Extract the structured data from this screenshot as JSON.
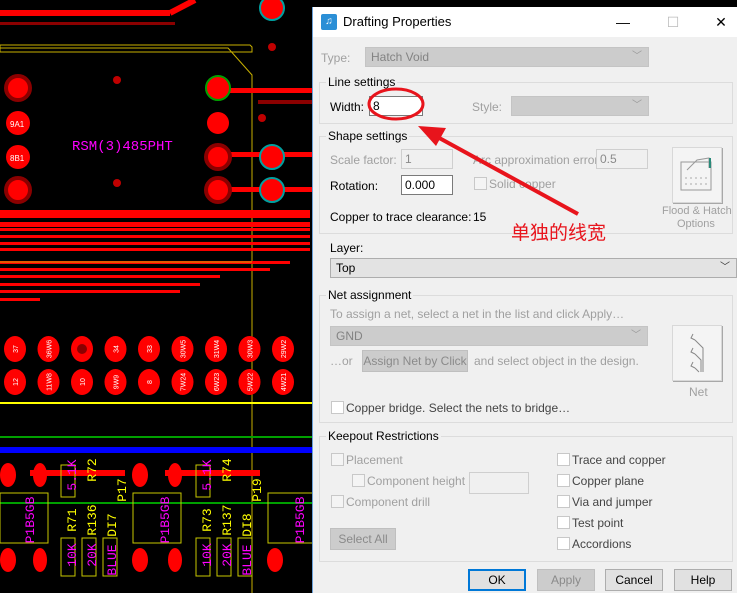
{
  "pcb": {
    "component_label": "RSM(3)485PHT",
    "pin_labels_left": [
      "9A1",
      "8B1"
    ],
    "header_pins_top": [
      "37",
      "36W6",
      "",
      "34",
      "33",
      "30W5",
      "31W4",
      "30W3",
      "29W2"
    ],
    "header_pins_bottom": [
      "12",
      "11W8",
      "10",
      "9W9",
      "8",
      "7W24",
      "6W23",
      "5W22",
      "4W21"
    ],
    "bottom_parts": [
      "P1B5GB",
      "R71",
      "R136",
      "DI7",
      "R72",
      "P17",
      "5.1K",
      "10K",
      "20K",
      "BLUE",
      "P1B5GB",
      "R73",
      "R137",
      "DI8",
      "R74",
      "P19",
      "5.1K",
      "10K",
      "20K",
      "BLUE",
      "P1B5GB"
    ],
    "colors": {
      "background": "#000000",
      "copper_top": "#ff0000",
      "copper_dark": "#8b0000",
      "silkscreen": "#ffff00",
      "label": "#ff00ff",
      "green": "#00a000",
      "blue": "#0000ff"
    }
  },
  "dialog": {
    "title": "Drafting Properties",
    "window_buttons": {
      "minimize": "—",
      "maximize": "☐",
      "close": "✕"
    },
    "type": {
      "label": "Type:",
      "value": "Hatch Void"
    },
    "line_settings": {
      "title": "Line settings",
      "width_label": "Width:",
      "width_value": "8",
      "style_label": "Style:",
      "style_value": ""
    },
    "shape_settings": {
      "title": "Shape settings",
      "scale_factor_label": "Scale factor:",
      "scale_factor_value": "1",
      "arc_error_label": "Arc approximation error:",
      "arc_error_value": "0.5",
      "rotation_label": "Rotation:",
      "rotation_value": "0.000",
      "solid_copper_label": "Solid copper",
      "solid_copper_checked": false,
      "clearance_label": "Copper to trace clearance:",
      "clearance_value": "15",
      "flood_hatch_label_1": "Flood & Hatch",
      "flood_hatch_label_2": "Options"
    },
    "layer": {
      "label": "Layer:",
      "value": "Top"
    },
    "net_assignment": {
      "title": "Net assignment",
      "hint": "To assign a net, select a net in the list and click Apply…",
      "net_value": "GND",
      "or_label": "…or",
      "assign_button": "Assign Net by Click",
      "assign_suffix": "and select object in the design.",
      "net_button_label": "Net",
      "copper_bridge_label": "Copper bridge. Select the nets to bridge…"
    },
    "keepout": {
      "title": "Keepout Restrictions",
      "left": [
        {
          "label": "Placement",
          "checked": false
        },
        {
          "label": "Component height",
          "checked": false
        },
        {
          "label": "Component drill",
          "checked": false
        }
      ],
      "component_height_value": "",
      "select_all": "Select All",
      "right": [
        {
          "label": "Trace and copper",
          "checked": false
        },
        {
          "label": "Copper plane",
          "checked": false
        },
        {
          "label": "Via and jumper",
          "checked": false
        },
        {
          "label": "Test point",
          "checked": false
        },
        {
          "label": "Accordions",
          "checked": false
        }
      ]
    },
    "buttons": {
      "ok": "OK",
      "apply": "Apply",
      "cancel": "Cancel",
      "help": "Help"
    }
  },
  "annotation": {
    "text": "单独的线宽",
    "color": "#e8141c"
  }
}
